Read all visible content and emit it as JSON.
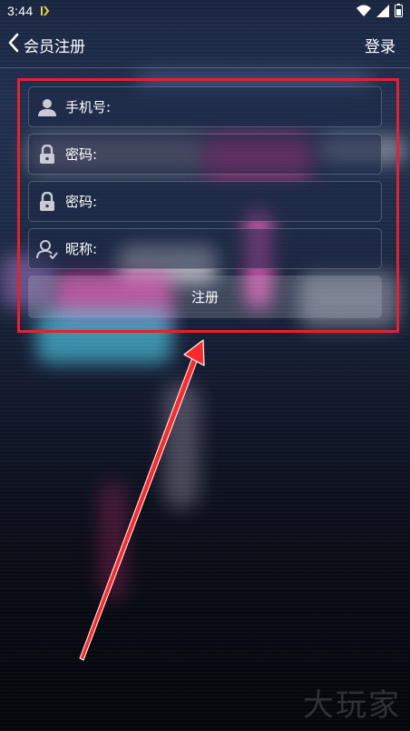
{
  "status_bar": {
    "time": "3:44"
  },
  "header": {
    "back_label": "会员注册",
    "login_label": "登录"
  },
  "form": {
    "phone_label": "手机号:",
    "password_label": "密码:",
    "confirm_password_label": "密码:",
    "nickname_label": "昵称:",
    "submit_label": "注册"
  },
  "annotation": {
    "highlight_color": "#e8202a"
  },
  "watermark": {
    "text": "大玩家"
  },
  "icons": {
    "phone_field": "person-icon",
    "password_field": "lock-icon",
    "confirm_password_field": "lock-icon",
    "nickname_field": "person-outline-icon",
    "back": "chevron-left-icon"
  }
}
